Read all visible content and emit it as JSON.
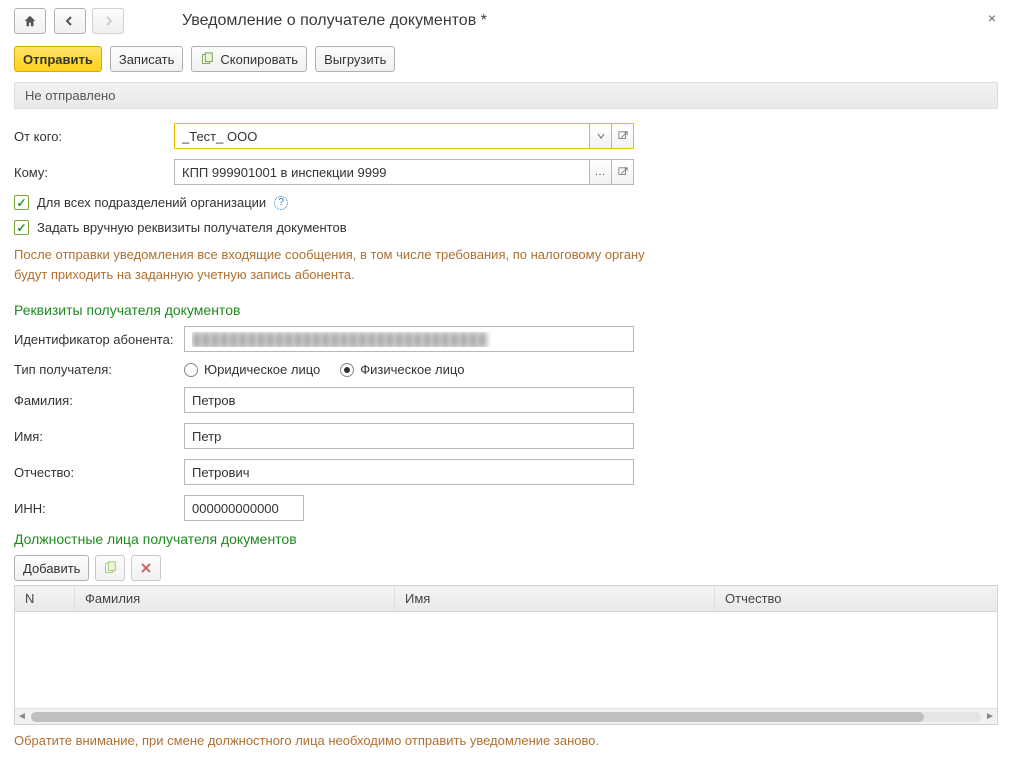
{
  "header": {
    "title": "Уведомление о получателе документов *"
  },
  "toolbar": {
    "send": "Отправить",
    "save": "Записать",
    "copy": "Скопировать",
    "export": "Выгрузить"
  },
  "status": "Не отправлено",
  "form": {
    "from_label": "От кого:",
    "from_value": "_Тест_ ООО",
    "to_label": "Кому:",
    "to_value": "КПП 999901001 в инспекции 9999",
    "all_subdiv_label": "Для всех подразделений организации",
    "manual_req_label": "Задать вручную реквизиты получателя документов"
  },
  "note": "После отправки уведомления все входящие сообщения, в том числе требования, по налоговому органу будут приходить на заданную учетную запись абонента.",
  "recipient": {
    "heading": "Реквизиты получателя документов",
    "id_label": "Идентификатор абонента:",
    "id_value": "████████████████████████████████",
    "type_label": "Тип получателя:",
    "type_legal": "Юридическое лицо",
    "type_individual": "Физическое лицо",
    "surname_label": "Фамилия:",
    "surname_value": "Петров",
    "name_label": "Имя:",
    "name_value": "Петр",
    "patronymic_label": "Отчество:",
    "patronymic_value": "Петрович",
    "inn_label": "ИНН:",
    "inn_value": "000000000000"
  },
  "officials": {
    "heading": "Должностные лица получателя документов",
    "add": "Добавить",
    "columns": {
      "n": "N",
      "surname": "Фамилия",
      "name": "Имя",
      "patronymic": "Отчество"
    },
    "rows": []
  },
  "footnote": "Обратите внимание, при смене должностного лица необходимо отправить уведомление заново."
}
